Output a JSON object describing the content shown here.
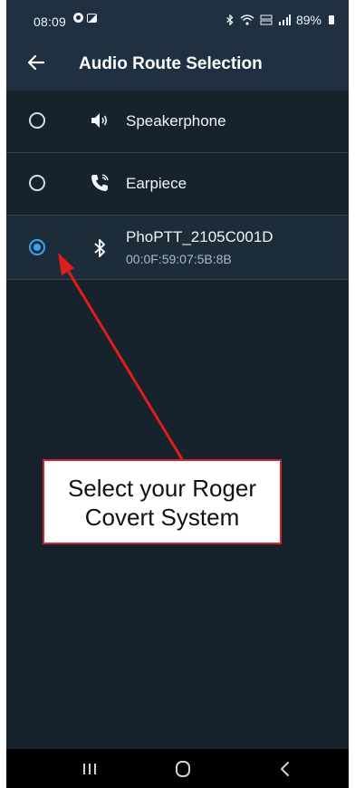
{
  "status_bar": {
    "time": "08:09",
    "right_text": "89%",
    "icons": [
      "location-dot-icon",
      "image-icon",
      "bluetooth-icon",
      "wifi-icon",
      "volte-icon",
      "signal-icon",
      "battery-icon"
    ]
  },
  "app_bar": {
    "back_icon": "arrow-left-icon",
    "title": "Audio Route Selection"
  },
  "routes": [
    {
      "label": "Speakerphone",
      "icon": "speaker-icon",
      "selected": false
    },
    {
      "label": "Earpiece",
      "icon": "phone-handset-icon",
      "selected": false
    },
    {
      "label": "PhoPTT_2105C001D",
      "sub": "00:0F:59:07:5B:8B",
      "icon": "bluetooth-icon",
      "selected": true
    }
  ],
  "callout": {
    "line1": "Select your Roger",
    "line2": "Covert System",
    "color": "#d4232a"
  },
  "nav_bar": {
    "icons": [
      "recent-apps-icon",
      "home-icon",
      "back-chevron-icon"
    ]
  },
  "colors": {
    "accent": "#3aa6ee",
    "appbar": "#1f3140",
    "background": "#16222c"
  }
}
